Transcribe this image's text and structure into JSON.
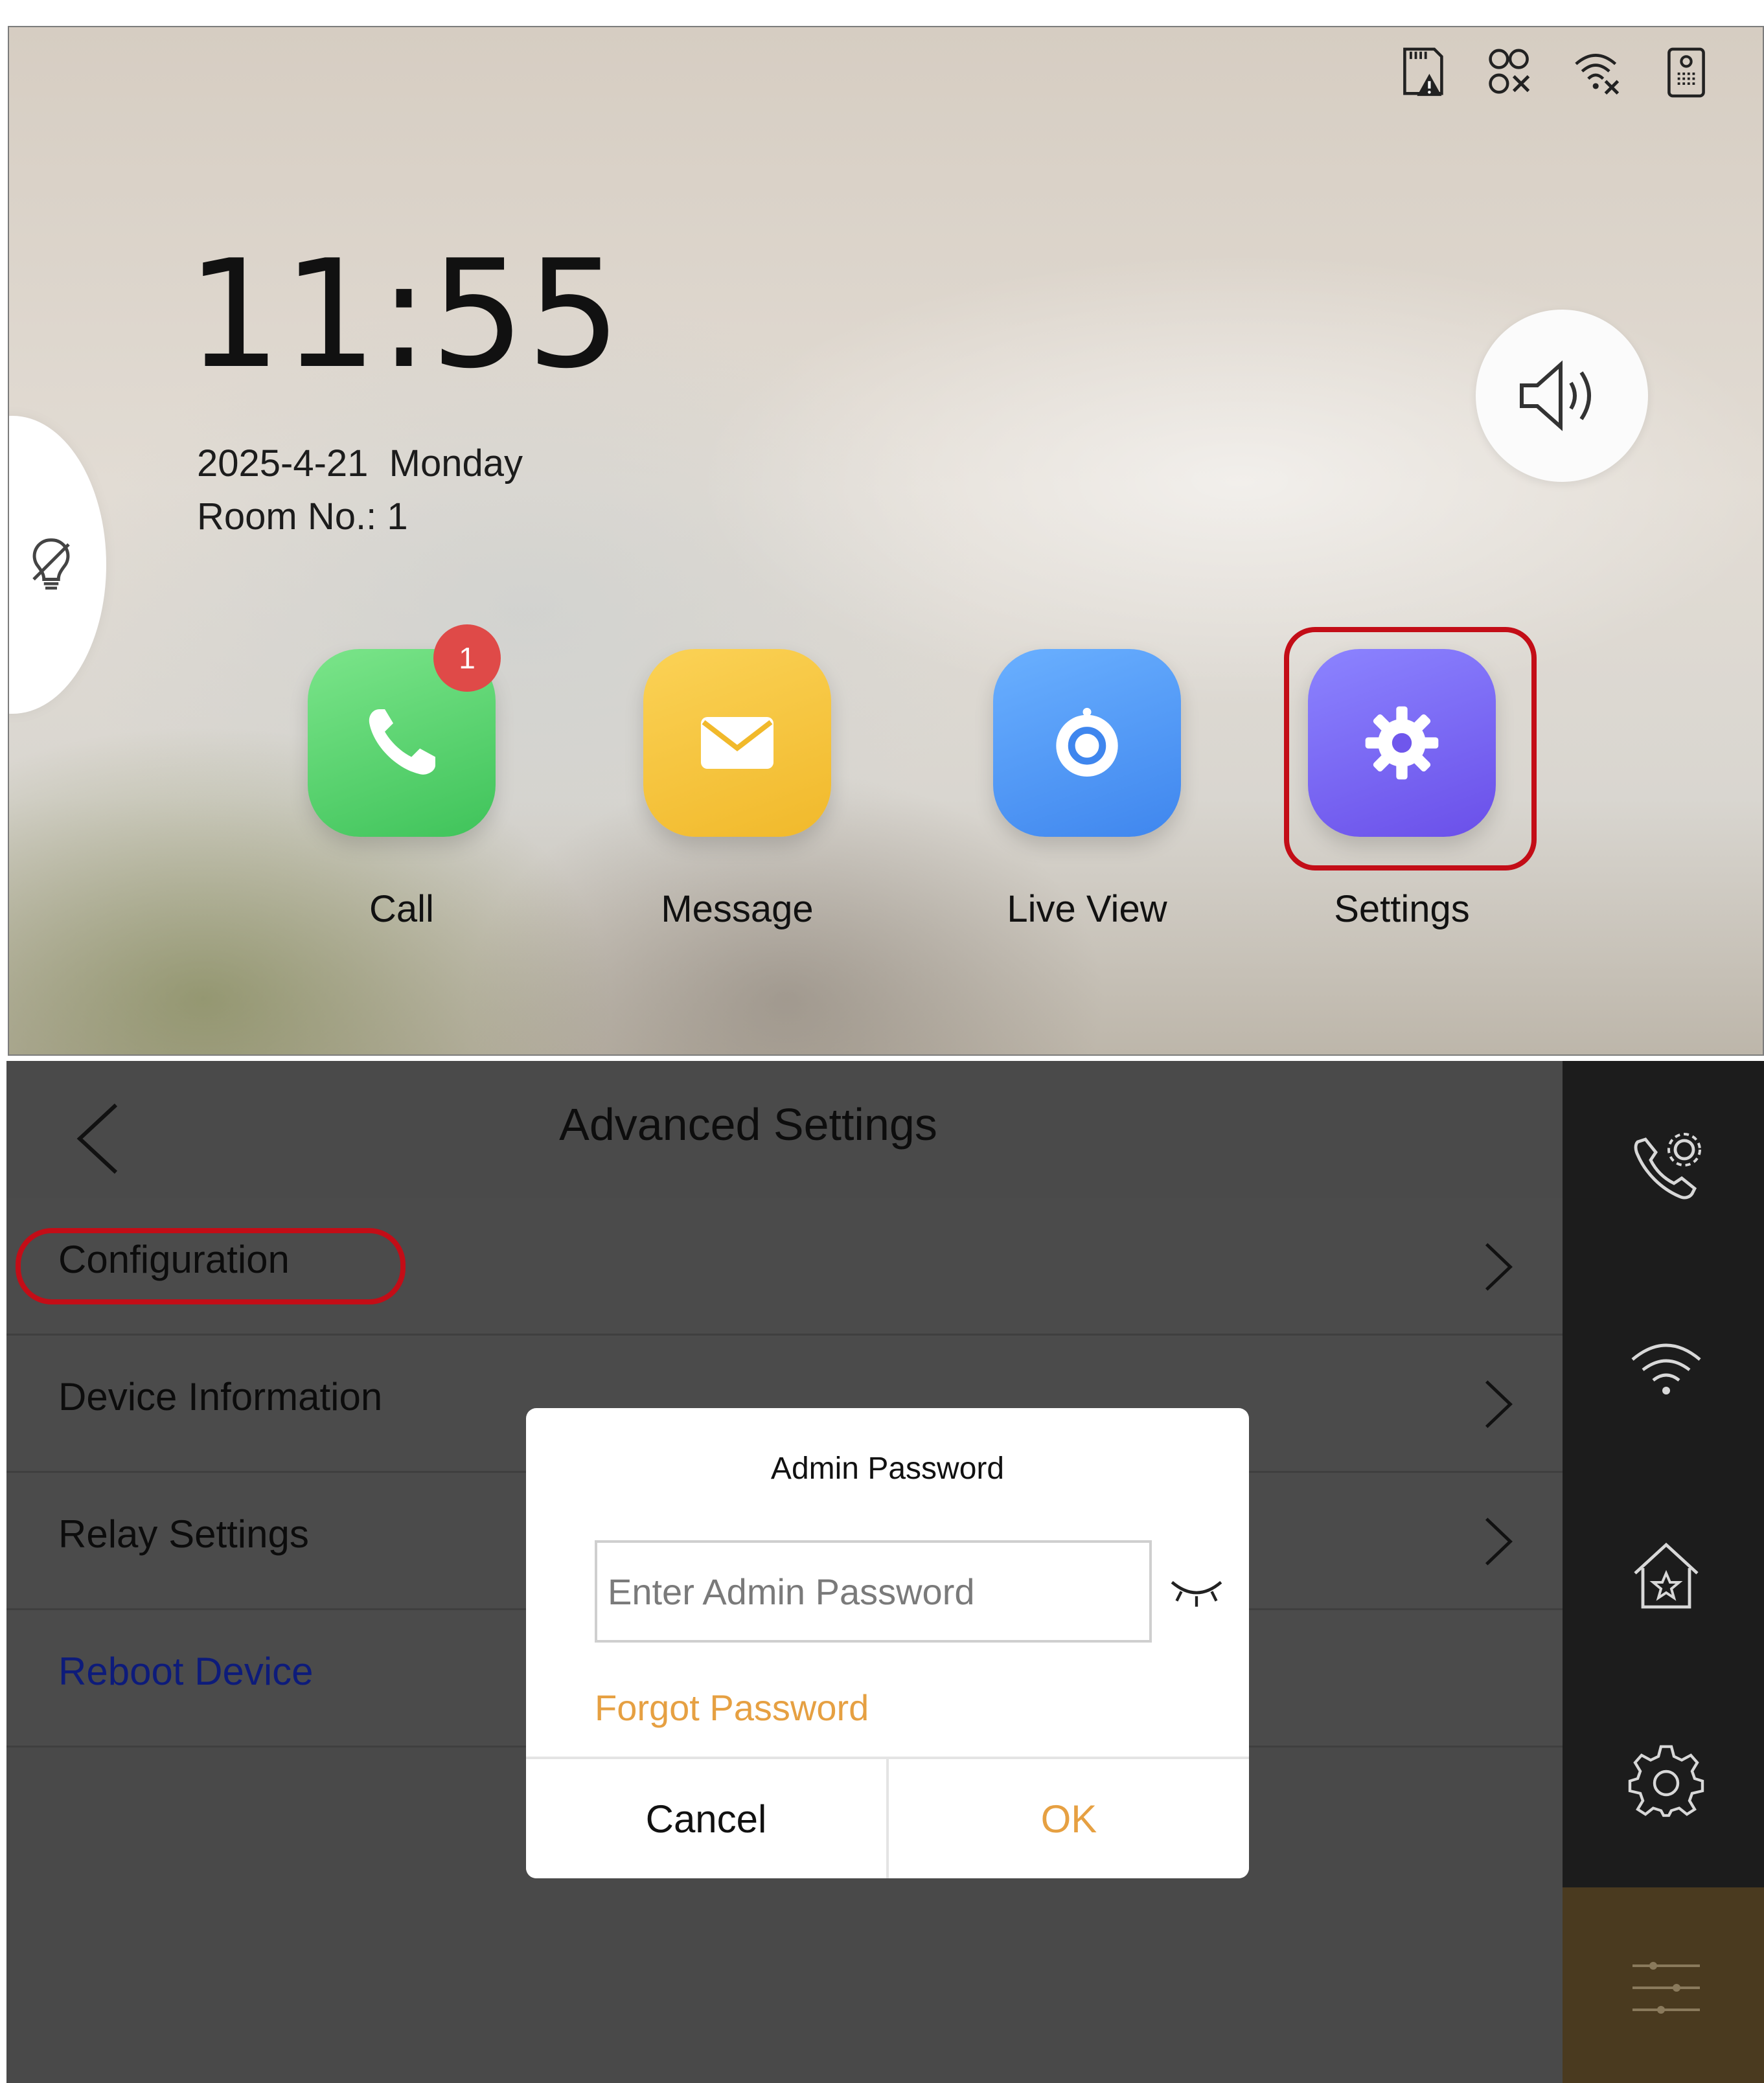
{
  "home": {
    "time": "11:55",
    "date": "2025-4-21  Monday",
    "room": "Room No.: 1",
    "status_icons": [
      "sd-card-warning-icon",
      "link-disconnected-icon",
      "wifi-disconnected-icon",
      "door-station-icon"
    ],
    "apps": [
      {
        "label": "Call",
        "icon": "phone-icon",
        "badge": "1",
        "color": "#4fd16a"
      },
      {
        "label": "Message",
        "icon": "envelope-icon",
        "color": "#f5c23a"
      },
      {
        "label": "Live View",
        "icon": "camera-icon",
        "color": "#4d95f4"
      },
      {
        "label": "Settings",
        "icon": "gear-icon",
        "color": "#7763f2"
      }
    ],
    "highlight_color": "#c30d17"
  },
  "advanced": {
    "title": "Advanced Settings",
    "items": [
      {
        "label": "Configuration"
      },
      {
        "label": "Device Information"
      },
      {
        "label": "Relay Settings"
      },
      {
        "label": "Reboot Device"
      }
    ],
    "sidebar_icons": [
      "call-settings-icon",
      "wifi-icon",
      "home-star-icon",
      "gear-icon",
      "sliders-icon"
    ]
  },
  "dialog": {
    "title": "Admin Password",
    "placeholder": "Enter Admin Password",
    "value": "",
    "forgot": "Forgot Password",
    "cancel": "Cancel",
    "ok": "OK",
    "accent": "#e6a042"
  }
}
